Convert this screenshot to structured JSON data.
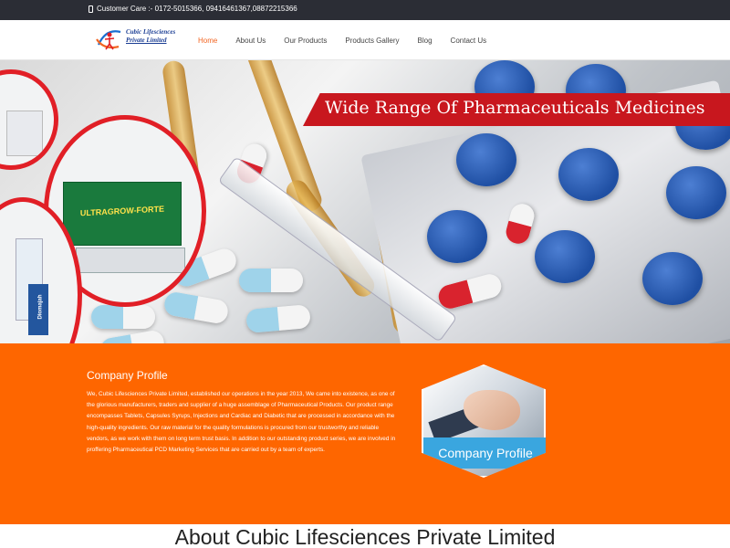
{
  "topbar": {
    "customer_care": "Customer Care :- 0172-5015366, 09416461367,08872215366"
  },
  "logo": {
    "line1": "Cubic Lifesciences",
    "line2": "Private Limited"
  },
  "nav": {
    "items": [
      {
        "label": "Home",
        "active": true
      },
      {
        "label": "About Us",
        "active": false
      },
      {
        "label": "Our Products",
        "active": false
      },
      {
        "label": "Products Gallery",
        "active": false
      },
      {
        "label": "Blog",
        "active": false
      },
      {
        "label": "Contact Us",
        "active": false
      }
    ]
  },
  "hero": {
    "banner_text": "Wide Range Of  Pharmaceuticals Medicines",
    "product_box_title": "ULTRAGROW-FORTE",
    "tube_label": "Diomajah",
    "slide_count": 2,
    "active_slide": 2
  },
  "profile": {
    "title": "Company Profile",
    "text": "We, Cubic Lifesciences Private Limited, established our operations in the year 2013, We came into existence, as one of the glorious manufacturers, traders and supplier of a huge assemblage of Pharmaceutical Products. Our product range encompasses Tablets, Capsules Syrups, Injections and Cardiac and Diabetic that are processed in accordance with the high-quality ingredients. Our raw material for the quality formulations is procured from our trustworthy and reliable vendors, as we work with them on long term trust basis. In addition to our outstanding product series, we are involved in proffering Pharmaceutical PCD Marketing Services that are carried out by a team of experts.",
    "image_label": "Company Profile"
  },
  "about": {
    "heading": "About Cubic Lifesciences Private Limited"
  },
  "colors": {
    "topbar": "#2b2d35",
    "accent": "#f26522",
    "section_bg": "#fe6600",
    "banner_red": "#c8171e",
    "profile_label": "#3aa6df"
  }
}
